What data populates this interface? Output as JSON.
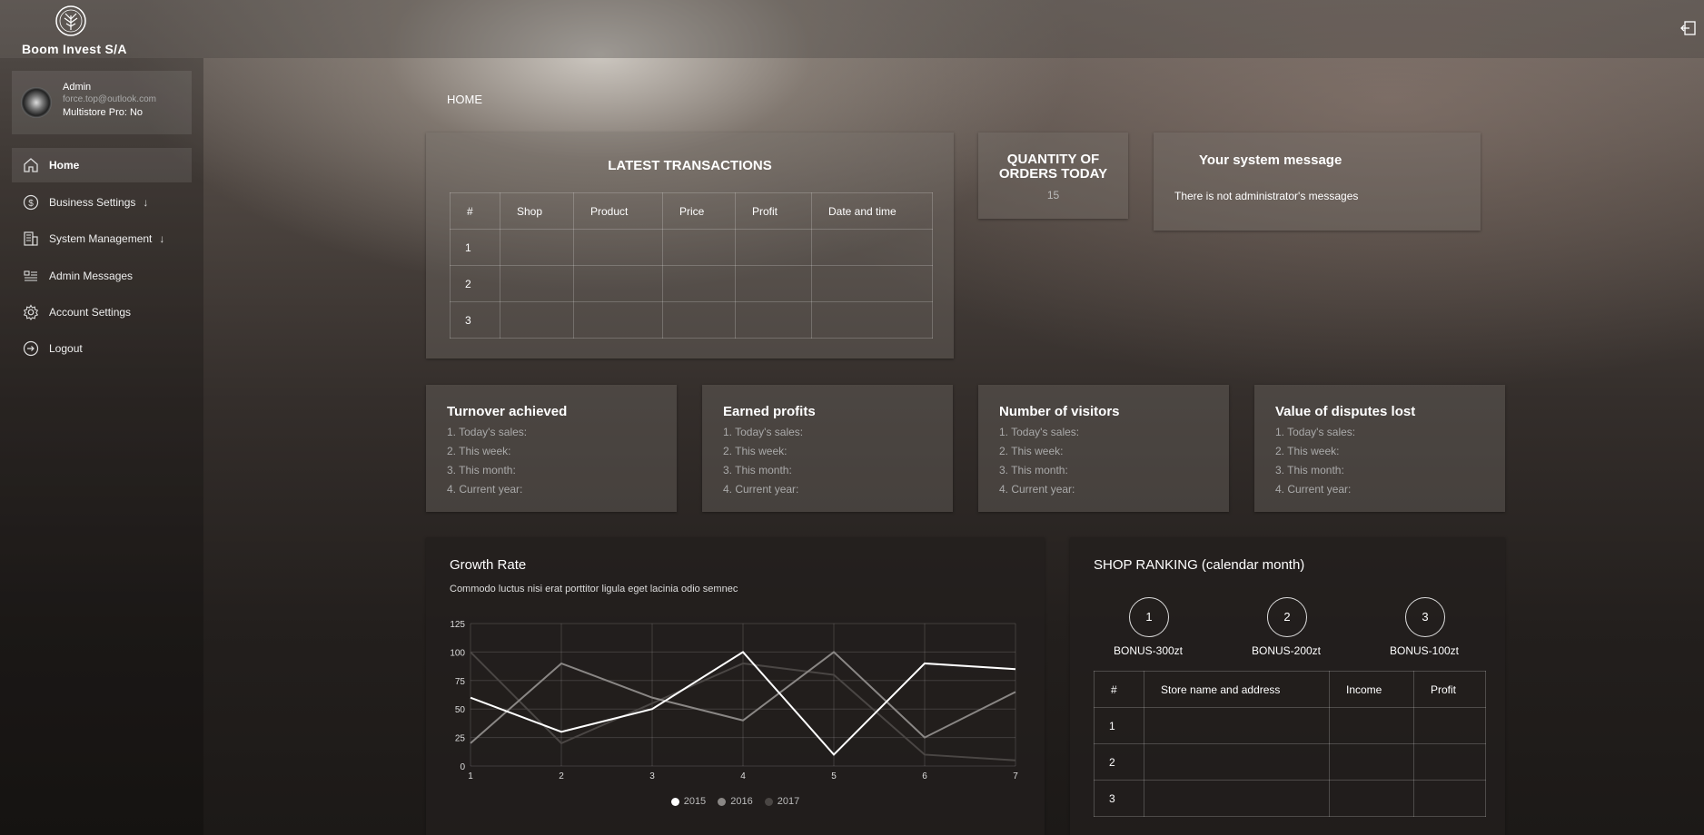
{
  "brand": {
    "name": "Boom Invest S/A",
    "logo_icon": "tree-emblem-icon"
  },
  "header": {
    "exit_icon": "logout-icon"
  },
  "profile": {
    "name": "Admin",
    "email": "force.top@outlook.com",
    "multistore": "Multistore Pro: No"
  },
  "sidebar": {
    "items": [
      {
        "label": "Home",
        "icon": "home-icon",
        "active": true
      },
      {
        "label": "Business Settings",
        "icon": "dollar-icon",
        "arrow": "↓"
      },
      {
        "label": "System Management",
        "icon": "building-icon",
        "arrow": "↓"
      },
      {
        "label": "Admin Messages",
        "icon": "message-list-icon"
      },
      {
        "label": "Account Settings",
        "icon": "gear-icon"
      },
      {
        "label": "Logout",
        "icon": "logout-circle-icon"
      }
    ]
  },
  "breadcrumb": "HOME",
  "latest_transactions": {
    "title": "LATEST TRANSACTIONS",
    "headers": [
      "#",
      "Shop",
      "Product",
      "Price",
      "Profit",
      "Date and time"
    ],
    "rows": [
      "1",
      "2",
      "3"
    ]
  },
  "orders_today": {
    "title": "QUANTITY OF ORDERS TODAY",
    "value": "15"
  },
  "system_message": {
    "title": "Your system message",
    "text": "There is not administrator's messages"
  },
  "stats": [
    {
      "title": "Turnover achieved",
      "lines": [
        "1. Today's sales:",
        "2. This week:",
        "3. This month:",
        "4. Current year:"
      ]
    },
    {
      "title": "Earned profits",
      "lines": [
        "1. Today's sales:",
        "2. This week:",
        "3. This month:",
        "4. Current year:"
      ]
    },
    {
      "title": "Number of visitors",
      "lines": [
        "1. Today's sales:",
        "2. This week:",
        "3. This month:",
        "4. Current year:"
      ]
    },
    {
      "title": "Value of disputes lost",
      "lines": [
        "1. Today's sales:",
        "2. This week:",
        "3. This month:",
        "4. Current year:"
      ]
    }
  ],
  "growth": {
    "title": "Growth Rate",
    "subtitle": "Commodo luctus nisi erat porttitor ligula eget lacinia odio semnec"
  },
  "chart_data": {
    "type": "line",
    "x": [
      1,
      2,
      3,
      4,
      5,
      6,
      7
    ],
    "ylim": [
      0,
      125
    ],
    "yticks": [
      0,
      25,
      50,
      75,
      100,
      125
    ],
    "grid": true,
    "legend_position": "bottom",
    "series": [
      {
        "name": "2015",
        "color": "#ffffff",
        "values": [
          60,
          30,
          50,
          100,
          10,
          90,
          85
        ]
      },
      {
        "name": "2016",
        "color": "#8a8785",
        "values": [
          20,
          90,
          60,
          40,
          100,
          25,
          65
        ]
      },
      {
        "name": "2017",
        "color": "#4a4644",
        "values": [
          100,
          20,
          55,
          90,
          80,
          10,
          5
        ]
      }
    ]
  },
  "shop_ranking": {
    "title": "SHOP RANKING (calendar month)",
    "places": [
      {
        "rank": "1",
        "bonus": "BONUS-300zt"
      },
      {
        "rank": "2",
        "bonus": "BONUS-200zt"
      },
      {
        "rank": "3",
        "bonus": "BONUS-100zt"
      }
    ],
    "headers": [
      "#",
      "Store name and address",
      "Income",
      "Profit"
    ],
    "rows": [
      "1",
      "2",
      "3"
    ]
  }
}
